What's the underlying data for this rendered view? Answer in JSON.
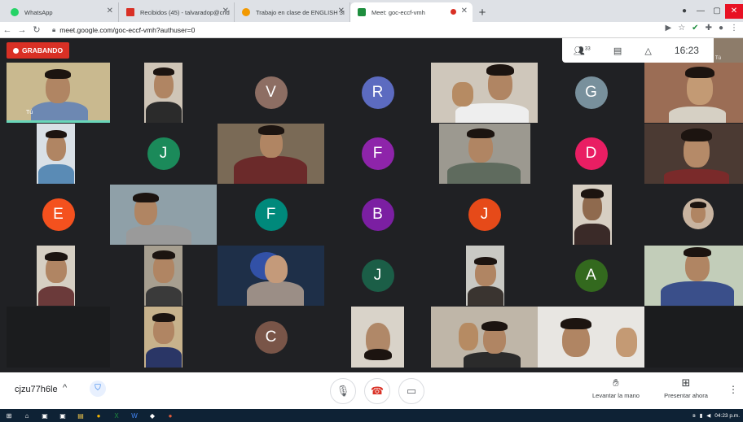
{
  "browser": {
    "tabs": [
      {
        "label": "WhatsApp",
        "color": "#25d366",
        "active": false
      },
      {
        "label": "Recibidos (45) - talvaradop@cnd",
        "color": "#d93025",
        "active": false
      },
      {
        "label": "Trabajo en clase de ENGLISH 3I",
        "color": "#f29900",
        "active": false
      },
      {
        "label": "Meet: goc-eccf-vmh",
        "color": "#1e8e3e",
        "active": true
      }
    ],
    "new_tab": "+",
    "url": "meet.google.com/goc-eccf-vmh?authuser=0"
  },
  "meet": {
    "recording_label": "GRABANDO",
    "participants_count": "33",
    "clock": "16:23",
    "self_label": "Tú",
    "meeting_code": "cjzu77h6le",
    "raise_hand_label": "Levantar la mano",
    "present_label": "Presentar ahora"
  },
  "avatars": [
    {
      "letter": "V",
      "color": "#8d6e63"
    },
    {
      "letter": "R",
      "color": "#5c6bc0"
    },
    {
      "letter": "G",
      "color": "#78909c"
    },
    {
      "letter": "J",
      "color": "#1b8a5a"
    },
    {
      "letter": "F",
      "color": "#8e24aa"
    },
    {
      "letter": "D",
      "color": "#e91e63"
    },
    {
      "letter": "E",
      "color": "#f4511e"
    },
    {
      "letter": "F",
      "color": "#00897b"
    },
    {
      "letter": "B",
      "color": "#7b1fa2"
    },
    {
      "letter": "J",
      "color": "#e64a19"
    },
    {
      "letter": "J",
      "color": "#1b5e47"
    },
    {
      "letter": "A",
      "color": "#33691e"
    },
    {
      "letter": "C",
      "color": "#795548"
    }
  ],
  "taskbar": {
    "time": "04:23 p.m."
  }
}
